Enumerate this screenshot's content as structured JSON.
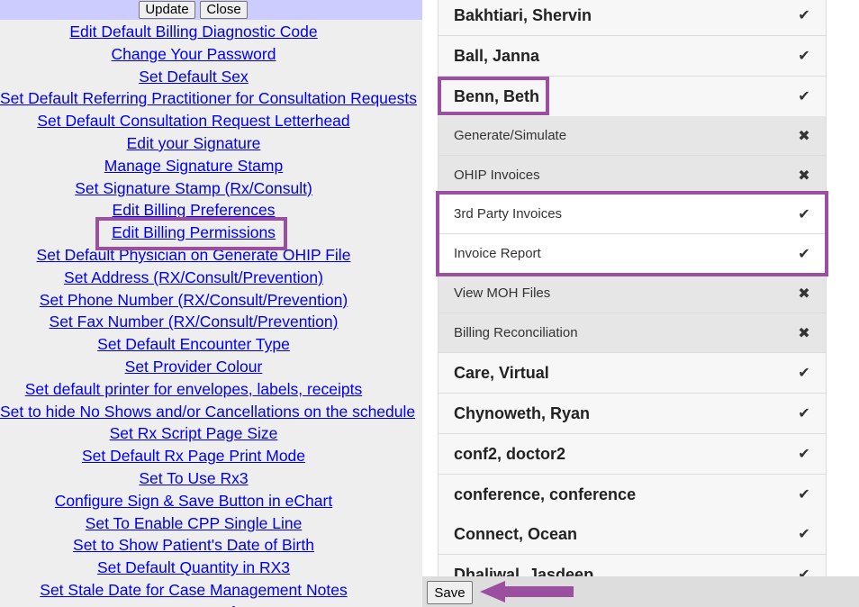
{
  "left": {
    "buttons": {
      "update": "Update",
      "close": "Close"
    },
    "links": [
      "Edit Default Billing Diagnostic Code",
      "Change Your Password",
      "Set Default Sex",
      "Set Default Referring Practitioner for Consultation Requests",
      "Set Default Consultation Request Letterhead",
      "Edit your Signature",
      "Manage Signature Stamp",
      "Set Signature Stamp (Rx/Consult)",
      "Edit Billing Preferences",
      "Edit Billing Permissions",
      "Set Default Physician on Generate OHIP File",
      "Set Address (RX/Consult/Prevention)",
      "Set Phone Number (RX/Consult/Prevention)",
      "Set Fax Number (RX/Consult/Prevention)",
      "Set Default Encounter Type",
      "Set Provider Colour",
      "Set default printer for envelopes, labels, receipts",
      "Set to hide No Shows and/or Cancellations on the schedule",
      "Set Rx Script Page Size",
      "Set Default Rx Page Print Mode",
      "Set To Use Rx3",
      "Configure Sign & Save Button in eChart",
      "Set To Enable CPP Single Line",
      "Set to Show Patient's Date of Birth",
      "Set Default Quantity in RX3",
      "Set Stale Date for Case Management Notes",
      "Set up Drug of IP"
    ]
  },
  "right": {
    "rows": [
      {
        "label": "Bakhtiari, Shervin",
        "type": "provider",
        "status": "check"
      },
      {
        "label": "Ball, Janna",
        "type": "provider",
        "status": "check"
      },
      {
        "label": "Benn, Beth",
        "type": "provider",
        "status": "check"
      },
      {
        "label": "Generate/Simulate",
        "type": "permission",
        "status": "cross"
      },
      {
        "label": "OHIP Invoices",
        "type": "permission",
        "status": "cross"
      },
      {
        "label": "3rd Party Invoices",
        "type": "permission",
        "status": "check"
      },
      {
        "label": "Invoice Report",
        "type": "permission",
        "status": "check"
      },
      {
        "label": "View MOH Files",
        "type": "permission",
        "status": "cross"
      },
      {
        "label": "Billing Reconciliation",
        "type": "permission",
        "status": "cross"
      },
      {
        "label": "Care, Virtual",
        "type": "provider",
        "status": "check"
      },
      {
        "label": "Chynoweth, Ryan",
        "type": "provider",
        "status": "check"
      },
      {
        "label": "conf2, doctor2",
        "type": "provider",
        "status": "check"
      },
      {
        "label": "conference, conference",
        "type": "provider",
        "status": "check"
      },
      {
        "label": "Connect, Ocean",
        "type": "provider",
        "status": "check"
      },
      {
        "label": "Dhaliwal, Jasdeep",
        "type": "provider",
        "status": "check"
      }
    ],
    "save_label": "Save"
  },
  "icons": {
    "check": "check-icon",
    "cross": "cross-icon"
  },
  "colors": {
    "link": "#0000ee",
    "topbar": "#ccccff",
    "annotation": "#9b4f9f"
  }
}
